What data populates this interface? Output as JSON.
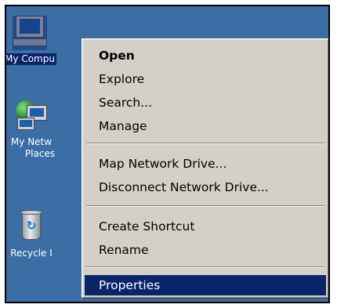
{
  "desktop": {
    "background_color": "#3a6ea5",
    "icons": [
      {
        "label": "My Compu",
        "icon": "my-computer-icon",
        "selected": true
      },
      {
        "label_line1": "My Netw",
        "label_line2": "Places",
        "icon": "network-places-icon"
      },
      {
        "label": "Recycle I",
        "icon": "recycle-bin-icon"
      }
    ]
  },
  "context_menu": {
    "highlight_color": "#0a246a",
    "items": [
      {
        "label": "Open",
        "default": true
      },
      {
        "label": "Explore"
      },
      {
        "label": "Search..."
      },
      {
        "label": "Manage"
      },
      {
        "label": "Map Network Drive..."
      },
      {
        "label": "Disconnect Network Drive..."
      },
      {
        "label": "Create Shortcut"
      },
      {
        "label": "Rename"
      },
      {
        "label": "Properties",
        "highlighted": true
      }
    ]
  }
}
